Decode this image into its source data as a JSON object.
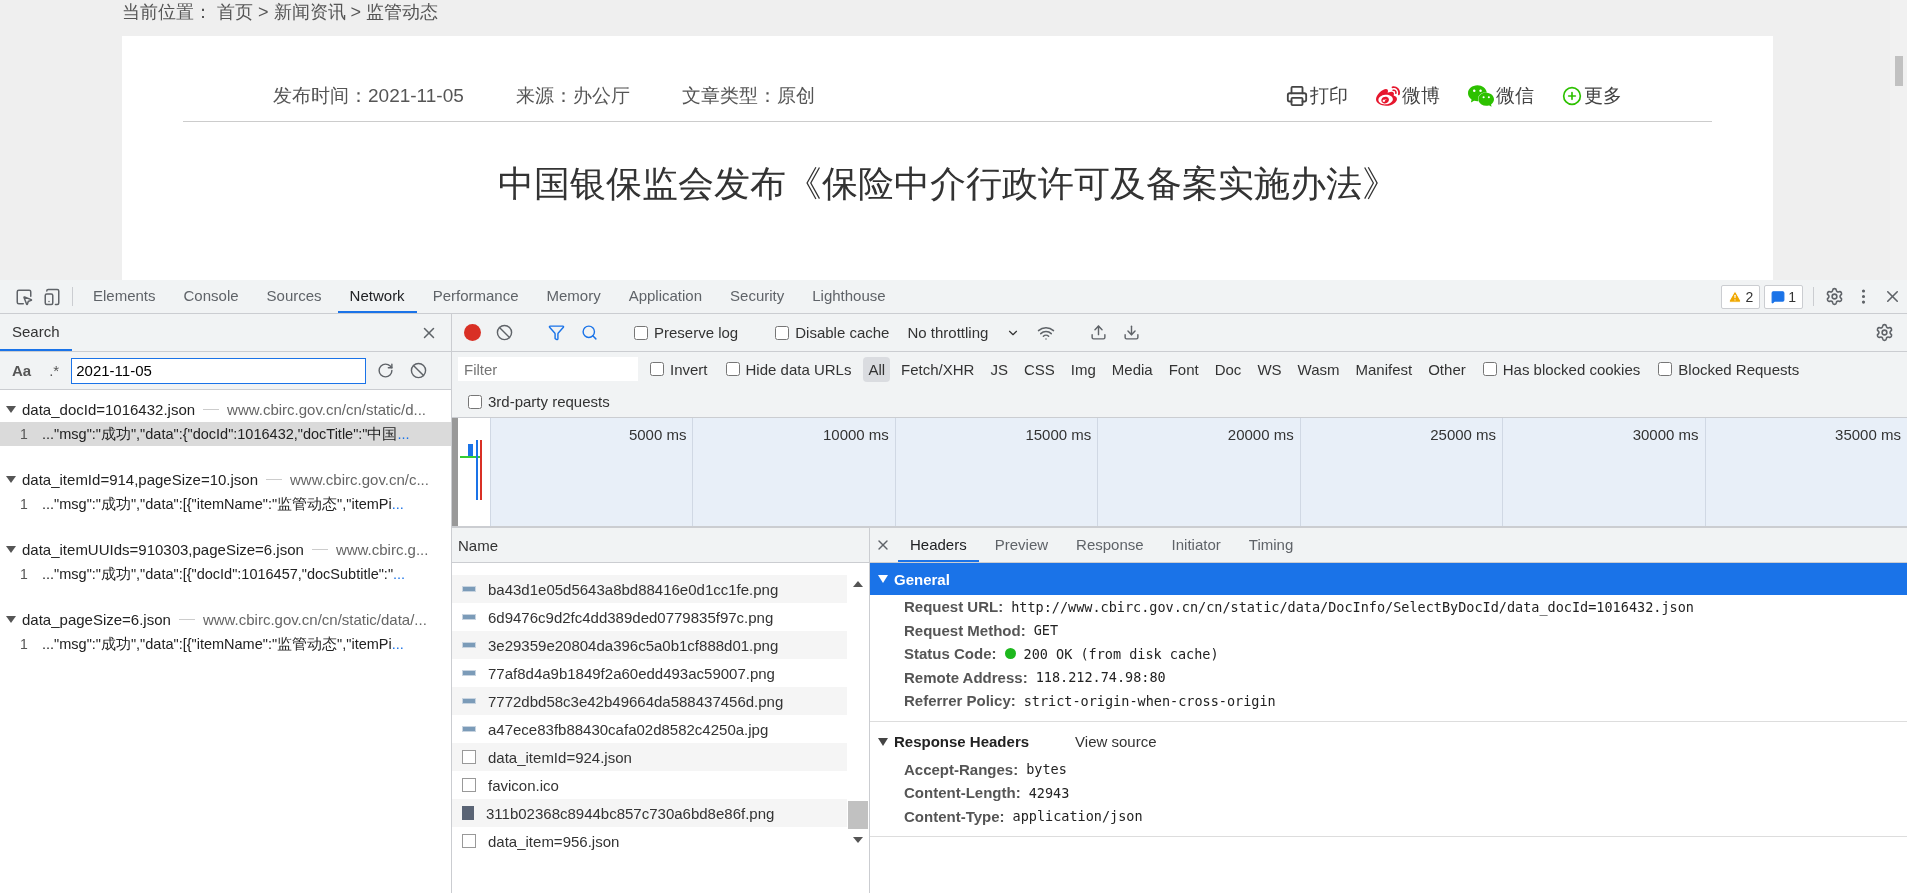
{
  "page": {
    "breadcrumb": "当前位置： 首页 > 新闻资讯 > 监管动态",
    "meta": [
      "发布时间：2021-11-05",
      "来源：办公厅",
      "文章类型：原创"
    ],
    "share": [
      {
        "kind": "print",
        "label": "打印"
      },
      {
        "kind": "weibo",
        "label": "微博"
      },
      {
        "kind": "wechat",
        "label": "微信"
      },
      {
        "kind": "more",
        "label": "更多"
      }
    ],
    "title": "中国银保监会发布《保险中介行政许可及备案实施办法》"
  },
  "devtools": {
    "tabs": [
      {
        "label": "Elements",
        "selected": false
      },
      {
        "label": "Console",
        "selected": false
      },
      {
        "label": "Sources",
        "selected": false
      },
      {
        "label": "Network",
        "selected": true
      },
      {
        "label": "Performance",
        "selected": false
      },
      {
        "label": "Memory",
        "selected": false
      },
      {
        "label": "Application",
        "selected": false
      },
      {
        "label": "Security",
        "selected": false
      },
      {
        "label": "Lighthouse",
        "selected": false
      }
    ],
    "warnings": "2",
    "messages": "1"
  },
  "search": {
    "title": "Search",
    "case": "Aa",
    "regex": ".*",
    "query": "2021-11-05",
    "results": [
      {
        "file": "data_docId=1016432.json",
        "url": "www.cbirc.gov.cn/cn/static/d...",
        "line": "1",
        "text": "...\"msg\":\"成功\",\"data\":{\"docId\":1016432,\"docTitle\":\"中国",
        "more": "...",
        "selected": true
      },
      {
        "file": "data_itemId=914,pageSize=10.json",
        "url": "www.cbirc.gov.cn/c...",
        "line": "1",
        "text": "...\"msg\":\"成功\",\"data\":[{\"itemName\":\"监管动态\",\"itemPi",
        "more": "...",
        "selected": false
      },
      {
        "file": "data_itemUUIds=910303,pageSize=6.json",
        "url": "www.cbirc.g...",
        "line": "1",
        "text": "...\"msg\":\"成功\",\"data\":[{\"docId\":1016457,\"docSubtitle\":\"",
        "more": "...",
        "selected": false
      },
      {
        "file": "data_pageSize=6.json",
        "url": "www.cbirc.gov.cn/cn/static/data/...",
        "line": "1",
        "text": "...\"msg\":\"成功\",\"data\":[{\"itemName\":\"监管动态\",\"itemPi",
        "more": "...",
        "selected": false
      }
    ]
  },
  "toolbar": {
    "recording": true,
    "preserve_log": {
      "label": "Preserve log",
      "checked": false
    },
    "disable_cache": {
      "label": "Disable cache",
      "checked": false
    },
    "throttling": "No throttling"
  },
  "filter": {
    "placeholder": "Filter",
    "invert": {
      "label": "Invert",
      "checked": false
    },
    "hide_data_urls": {
      "label": "Hide data URLs",
      "checked": false
    },
    "types": [
      {
        "label": "All",
        "selected": true
      },
      {
        "label": "Fetch/XHR",
        "selected": false
      },
      {
        "label": "JS",
        "selected": false
      },
      {
        "label": "CSS",
        "selected": false
      },
      {
        "label": "Img",
        "selected": false
      },
      {
        "label": "Media",
        "selected": false
      },
      {
        "label": "Font",
        "selected": false
      },
      {
        "label": "Doc",
        "selected": false
      },
      {
        "label": "WS",
        "selected": false
      },
      {
        "label": "Wasm",
        "selected": false
      },
      {
        "label": "Manifest",
        "selected": false
      },
      {
        "label": "Other",
        "selected": false
      }
    ],
    "has_blocked_cookies": {
      "label": "Has blocked cookies",
      "checked": false
    },
    "blocked_requests": {
      "label": "Blocked Requests",
      "checked": false
    },
    "third_party": {
      "label": "3rd-party requests",
      "checked": false
    }
  },
  "overview": {
    "ticks": [
      "5000 ms",
      "10000 ms",
      "15000 ms",
      "20000 ms",
      "25000 ms",
      "30000 ms",
      "35000 ms"
    ]
  },
  "requests": {
    "header": "Name",
    "rows": [
      {
        "name": "ba43d1e05d5643a8bd88416e0d1cc1fe.png",
        "kind": "image"
      },
      {
        "name": "6d9476c9d2fc4dd389ded0779835f97c.png",
        "kind": "image"
      },
      {
        "name": "3e29359e20804da396c5a0b1cf888d01.png",
        "kind": "image"
      },
      {
        "name": "77af8d4a9b1849f2a60edd493ac59007.png",
        "kind": "image"
      },
      {
        "name": "7772dbd58c3e42b49664da588437456d.png",
        "kind": "image"
      },
      {
        "name": "a47ece83fb88430cafa02d8582c4250a.jpg",
        "kind": "image"
      },
      {
        "name": "data_itemId=924.json",
        "kind": "doc"
      },
      {
        "name": "favicon.ico",
        "kind": "doc"
      },
      {
        "name": "311b02368c8944bc857c730a6bd8e86f.png",
        "kind": "photo"
      },
      {
        "name": "data_item=956.json",
        "kind": "doc"
      }
    ]
  },
  "details": {
    "tabs": [
      {
        "label": "Headers",
        "selected": true
      },
      {
        "label": "Preview",
        "selected": false
      },
      {
        "label": "Response",
        "selected": false
      },
      {
        "label": "Initiator",
        "selected": false
      },
      {
        "label": "Timing",
        "selected": false
      }
    ],
    "sections": [
      {
        "title": "General",
        "expanded": true,
        "highlighted": true,
        "rows": [
          {
            "key": "Request URL:",
            "value": "http://www.cbirc.gov.cn/cn/static/data/DocInfo/SelectByDocId/data_docId=1016432.json",
            "kind": "text"
          },
          {
            "key": "Request Method:",
            "value": "GET",
            "kind": "text"
          },
          {
            "key": "Status Code:",
            "value": "200 OK (from disk cache)",
            "kind": "status",
            "color": "#1db81d"
          },
          {
            "key": "Remote Address:",
            "value": "118.212.74.98:80",
            "kind": "text"
          },
          {
            "key": "Referrer Policy:",
            "value": "strict-origin-when-cross-origin",
            "kind": "text"
          }
        ]
      },
      {
        "title": "Response Headers",
        "expanded": true,
        "highlighted": false,
        "link": "View source",
        "rows": [
          {
            "key": "Accept-Ranges:",
            "value": "bytes",
            "kind": "text"
          },
          {
            "key": "Content-Length:",
            "value": "42943",
            "kind": "text"
          },
          {
            "key": "Content-Type:",
            "value": "application/json",
            "kind": "text"
          }
        ]
      }
    ]
  }
}
